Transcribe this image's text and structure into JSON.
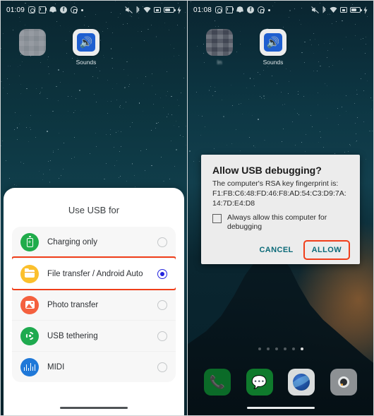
{
  "left_phone": {
    "status_bar": {
      "time": "01:09",
      "left_icons": [
        "camera-circle-icon",
        "mail-icon",
        "snapchat-ghost-icon",
        "facebook-icon",
        "badge-circle-icon",
        "dot-icon"
      ],
      "right_icons": [
        "mute-icon",
        "bluetooth-icon",
        "wifi-icon",
        "sim-card-icon",
        "battery-icon",
        "charging-bolt-icon"
      ]
    },
    "home": {
      "apps": [
        {
          "label": "",
          "icon": "blurred-app-icon"
        },
        {
          "label": "Sounds",
          "icon": "sounds-speaker-icon"
        }
      ]
    },
    "sheet": {
      "title": "Use USB for",
      "options": [
        {
          "label": "Charging only",
          "icon": "battery-icon",
          "selected": false
        },
        {
          "label": "File transfer / Android Auto",
          "icon": "folder-icon",
          "selected": true
        },
        {
          "label": "Photo transfer",
          "icon": "photo-icon",
          "selected": false
        },
        {
          "label": "USB tethering",
          "icon": "tethering-icon",
          "selected": false
        },
        {
          "label": "MIDI",
          "icon": "midi-icon",
          "selected": false
        }
      ]
    }
  },
  "right_phone": {
    "status_bar": {
      "time": "01:08",
      "left_icons": [
        "camera-circle-icon",
        "mail-icon",
        "snapchat-ghost-icon",
        "facebook-icon",
        "badge-circle-icon",
        "dot-icon"
      ],
      "right_icons": [
        "mute-icon",
        "bluetooth-icon",
        "wifi-icon",
        "sim-card-icon",
        "battery-icon",
        "charging-bolt-icon"
      ]
    },
    "home": {
      "apps": [
        {
          "label": "In",
          "icon": "blurred-app-icon"
        },
        {
          "label": "Sounds",
          "icon": "sounds-speaker-icon"
        }
      ],
      "page_dots": {
        "count": 6,
        "active_index": 5
      },
      "dock": [
        {
          "name": "phone",
          "icon": "phone-icon"
        },
        {
          "name": "messages",
          "icon": "messages-icon"
        },
        {
          "name": "browser",
          "icon": "browser-globe-icon"
        },
        {
          "name": "camera",
          "icon": "camera-icon"
        }
      ]
    },
    "dialog": {
      "title": "Allow USB debugging?",
      "body": "The computer's RSA key fingerprint is:",
      "fingerprint": "F1:FB:C6:48:FD:46:F8:AD:54:C3:D9:7A:14:7D:E4:D8",
      "checkbox_label": "Always allow this computer for debugging",
      "checkbox_checked": false,
      "cancel_label": "CANCEL",
      "allow_label": "ALLOW",
      "allow_highlighted": true
    }
  },
  "colors": {
    "highlight_red": "#f03e1a",
    "radio_selected_blue": "#2323dd",
    "dialog_button_teal": "#0b6a78",
    "charging_green": "#20ac4b",
    "file_yellow": "#fbc02d",
    "photo_orange": "#f4603e",
    "tethering_green": "#1faa4f",
    "midi_blue": "#1f78d8"
  }
}
